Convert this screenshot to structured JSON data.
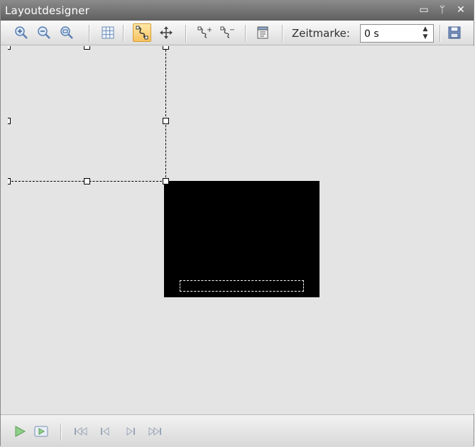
{
  "window": {
    "title": "Layoutdesigner",
    "buttons": {
      "restore": "▭",
      "pin": "ᛘ",
      "close": "✕"
    }
  },
  "toolbar": {
    "tools": [
      {
        "name": "zoom-in",
        "icon": "zoom-in-icon",
        "active": false
      },
      {
        "name": "zoom-out",
        "icon": "zoom-out-icon",
        "active": false
      },
      {
        "name": "zoom-fit",
        "icon": "zoom-fit-icon",
        "active": false
      },
      {
        "name": "grid",
        "icon": "grid-icon",
        "active": false
      },
      {
        "name": "path",
        "icon": "path-icon",
        "active": true
      },
      {
        "name": "move",
        "icon": "move-icon",
        "active": false
      },
      {
        "name": "add-keyframe",
        "icon": "path-add-icon",
        "active": false
      },
      {
        "name": "remove-keyframe",
        "icon": "path-remove-icon",
        "active": false
      },
      {
        "name": "properties",
        "icon": "properties-icon",
        "active": false
      },
      {
        "name": "save",
        "icon": "save-icon",
        "active": false
      }
    ],
    "zeitmarke_label": "Zeitmarke:",
    "zeitmarke_value": "0 s"
  },
  "playback": {
    "buttons": [
      "play-icon",
      "play-selection-icon",
      "first-frame-icon",
      "previous-frame-icon",
      "next-frame-icon",
      "last-frame-icon"
    ],
    "disabled": [
      "first-frame-icon",
      "previous-frame-icon",
      "next-frame-icon",
      "last-frame-icon"
    ]
  },
  "colors": {
    "accent": "#f7c25f",
    "canvas": "#e4e4e4",
    "object": "#000000"
  }
}
